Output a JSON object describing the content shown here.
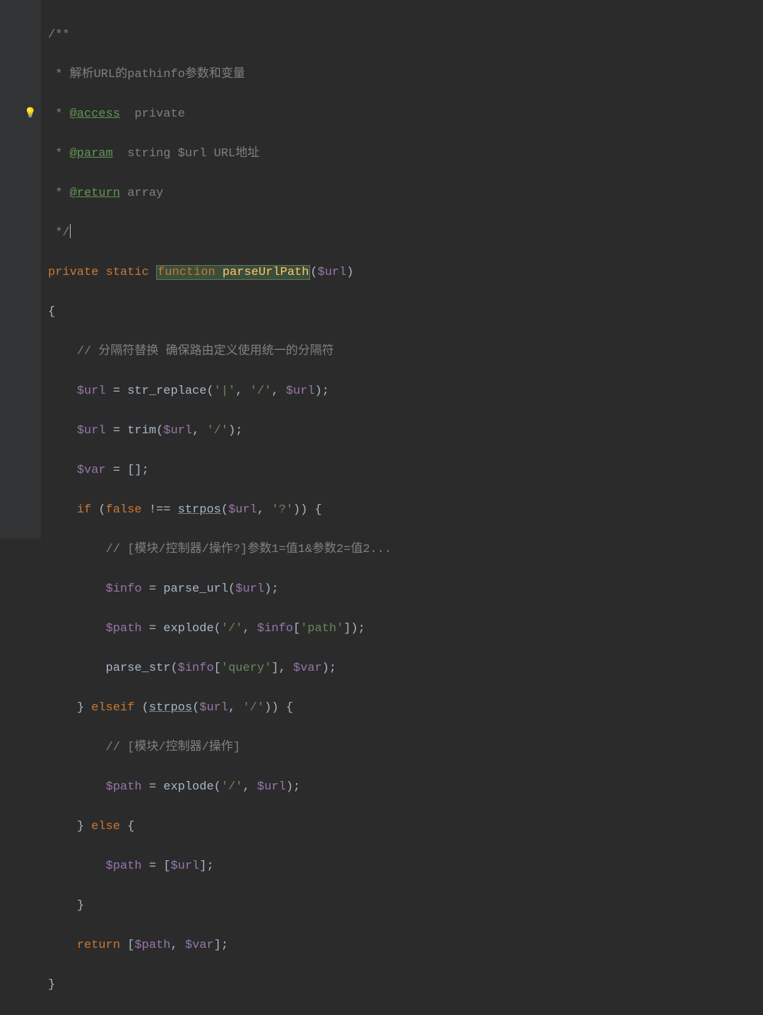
{
  "gutter": {
    "bulb_icon": "💡"
  },
  "code": {
    "l1": "/**",
    "l2_prefix": " * ",
    "l2_text": "解析URL的pathinfo参数和变量",
    "l3_prefix": " * ",
    "l3_tag": "@access",
    "l3_text": "  private",
    "l4_prefix": " * ",
    "l4_tag": "@param",
    "l4_text": "  string $url URL地址",
    "l5_prefix": " * ",
    "l5_tag": "@return",
    "l5_text": " array",
    "l6": " */",
    "l7_kw1": "private",
    "l7_kw2": "static",
    "l7_kw3": "function",
    "l7_func": "parseUrlPath",
    "l7_var": "$url",
    "l8": "{",
    "l9_comment": "// 分隔符替换 确保路由定义使用统一的分隔符",
    "l10_var": "$url",
    "l10_text1": " = str_replace(",
    "l10_str1": "'|'",
    "l10_text2": ", ",
    "l10_str2": "'/'",
    "l10_text3": ", ",
    "l10_var2": "$url",
    "l10_text4": ");",
    "l11_var": "$url",
    "l11_text1": " = trim(",
    "l11_var2": "$url",
    "l11_text2": ", ",
    "l11_str": "'/'",
    "l11_text3": ");",
    "l12_var": "$var",
    "l12_text": " = [];",
    "l13_kw": "if",
    "l13_text1": " (",
    "l13_kw2": "false",
    "l13_text2": " !== ",
    "l13_func": "strpos",
    "l13_text3": "(",
    "l13_var": "$url",
    "l13_text4": ", ",
    "l13_str": "'?'",
    "l13_text5": ")) {",
    "l14_comment": "// [模块/控制器/操作?]参数1=值1&参数2=值2...",
    "l15_var": "$info",
    "l15_text1": " = parse_url(",
    "l15_var2": "$url",
    "l15_text2": ");",
    "l16_var": "$path",
    "l16_text1": " = explode(",
    "l16_str": "'/'",
    "l16_text2": ", ",
    "l16_var2": "$info",
    "l16_text3": "[",
    "l16_str2": "'path'",
    "l16_text4": "]);",
    "l17_text1": "parse_str(",
    "l17_var": "$info",
    "l17_text2": "[",
    "l17_str": "'query'",
    "l17_text3": "], ",
    "l17_var2": "$var",
    "l17_text4": ");",
    "l18_text1": "} ",
    "l18_kw": "elseif",
    "l18_text2": " (",
    "l18_func": "strpos",
    "l18_text3": "(",
    "l18_var": "$url",
    "l18_text4": ", ",
    "l18_str": "'/'",
    "l18_text5": ")) {",
    "l19_comment": "// [模块/控制器/操作]",
    "l20_var": "$path",
    "l20_text1": " = explode(",
    "l20_str": "'/'",
    "l20_text2": ", ",
    "l20_var2": "$url",
    "l20_text3": ");",
    "l21_text1": "} ",
    "l21_kw": "else",
    "l21_text2": " {",
    "l22_var": "$path",
    "l22_text1": " = [",
    "l22_var2": "$url",
    "l22_text2": "];",
    "l23": "}",
    "l24_kw": "return",
    "l24_text1": " [",
    "l24_var1": "$path",
    "l24_text2": ", ",
    "l24_var2": "$var",
    "l24_text3": "];",
    "l25": "}"
  }
}
